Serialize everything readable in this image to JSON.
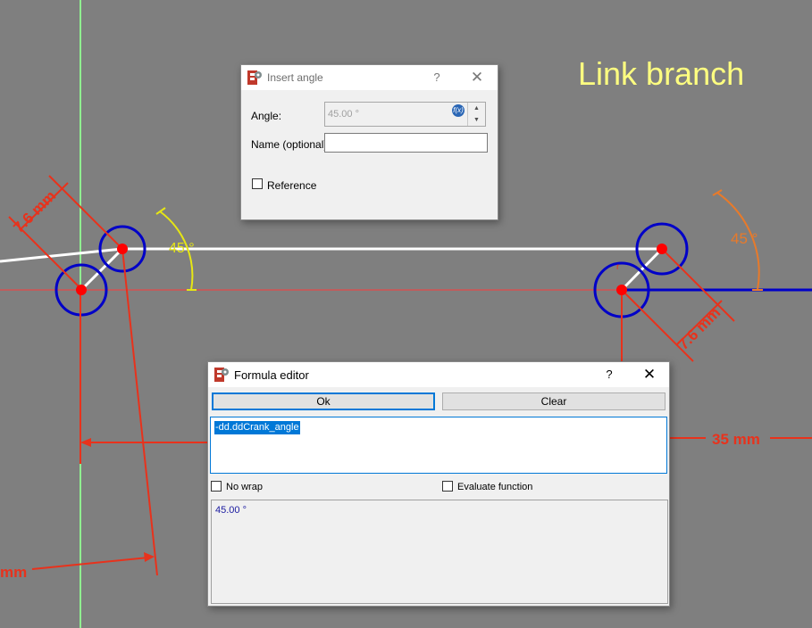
{
  "sketch": {
    "overlay_title": "Link branch",
    "dim_left_length": "7.6 mm",
    "dim_left_angle": "45 °",
    "dim_right_angle": "45 °",
    "dim_right_length": "7.6 mm",
    "dim_bottom_right": "35 mm",
    "dim_bottom_left": "mm",
    "colors": {
      "background": "#7f7f7f",
      "axis_green": "#90ee90",
      "construction_red": "#ff3b3b",
      "dimension_red": "#e8321c",
      "circle_blue": "#0000c8",
      "line_white": "#ffffff",
      "angle_yellow": "#e6e614",
      "angle_orange": "#e87a2a",
      "point_red": "#ff0000",
      "overlay_text": "#ffff80"
    }
  },
  "insert_angle_dialog": {
    "title": "Insert angle",
    "help_label": "?",
    "close_label": "✕",
    "angle_label": "Angle:",
    "angle_value": "45.00 °",
    "fx_label": "f(x)",
    "spin_up": "▲",
    "spin_down": "▼",
    "name_label": "Name (optional)",
    "name_value": "",
    "reference_label": "Reference"
  },
  "formula_editor": {
    "title": "Formula editor",
    "help_label": "?",
    "close_label": "✕",
    "ok_label": "Ok",
    "clear_label": "Clear",
    "expression": "-dd.ddCrank_angle",
    "no_wrap_label": "No wrap",
    "evaluate_label": "Evaluate function",
    "result": "45.00 °"
  }
}
